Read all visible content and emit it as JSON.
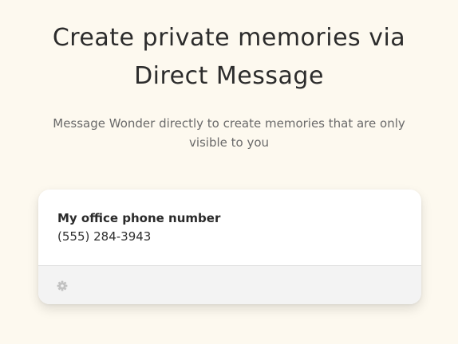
{
  "header": {
    "title_line1": "Create private memories via",
    "title_line2": "Direct Message",
    "subtitle_line1": "Message Wonder directly to create memories that are only",
    "subtitle_line2": "visible to you"
  },
  "memory_card": {
    "title": "My office phone number",
    "value": "(555) 284-3943",
    "footer_icon": "gear-icon"
  },
  "colors": {
    "background": "#fdf9ef",
    "card_background": "#ffffff",
    "footer_background": "#f3f3f3",
    "icon": "#c2c2c2"
  }
}
